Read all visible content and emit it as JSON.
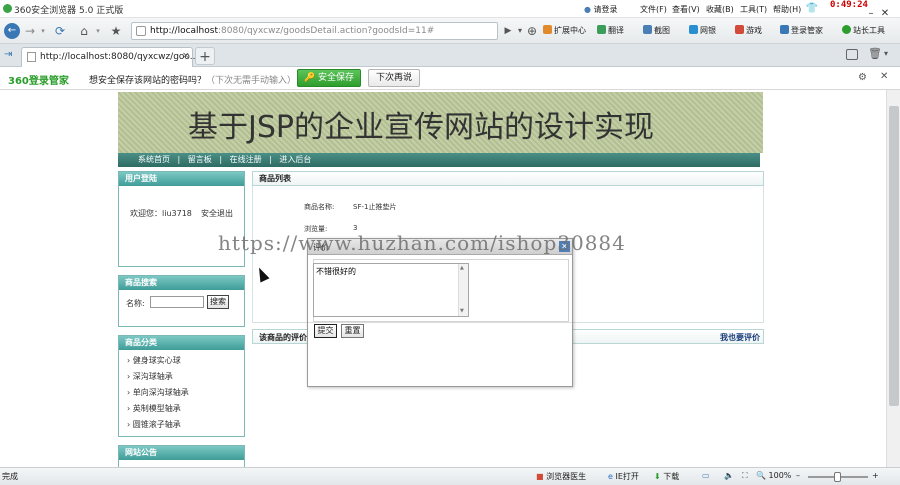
{
  "titlebar": {
    "title": "360安全浏览器 5.0 正式版",
    "login": "请登录",
    "menus": [
      "文件(F)",
      "查看(V)",
      "收藏(B)",
      "工具(T)",
      "帮助(H)"
    ],
    "clock": "0:49:24"
  },
  "navbar": {
    "url_host": "http://localhost",
    "url_rest": ":8080/qyxcwz/goodsDetail.action?goodsId=11#",
    "tools": [
      "扩展中心",
      "翻译",
      "截图",
      "网银",
      "游戏",
      "登录管家",
      "站长工具"
    ]
  },
  "tab": {
    "title": "http://localhost:8080/qyxcwz/goo...",
    "close": "×",
    "new_tab": "+"
  },
  "pwbar": {
    "brand": "360登录管家",
    "question": "想安全保存该网站的密码吗？",
    "hint": "（下次无需手动输入）",
    "save": "安全保存",
    "later": "下次再说"
  },
  "site": {
    "title": "基于JSP的企业宣传网站的设计实现",
    "nav": [
      "系统首页",
      "留言板",
      "在线注册",
      "进入后台"
    ],
    "nav_sep": "|"
  },
  "sidebar": {
    "login_title": "用户登陆",
    "welcome": "欢迎您：liu3718",
    "logout": "安全退出",
    "search_title": "商品搜索",
    "search_label": "名称:",
    "search_btn": "搜索",
    "category_title": "商品分类",
    "categories": [
      "健身球实心球",
      "深沟球轴承",
      "单向深沟球轴承",
      "英制模型轴承",
      "圆锥滚子轴承"
    ],
    "notice_title": "网站公告"
  },
  "main": {
    "list_title": "商品列表",
    "name_label": "商品名称:",
    "name_value": "SF-1止推垫片",
    "views_label": "浏览量:",
    "views_value": "3",
    "review_title": "该商品的评价",
    "review_link": "我也要评价"
  },
  "popup": {
    "title": "评价",
    "close": "✕",
    "text": "不错很好的",
    "submit": "提交",
    "reset": "重置"
  },
  "watermark": "https://www.huzhan.com/ishop30884",
  "statusbar": {
    "left": "完成",
    "doctor": "浏览器医生",
    "ie": "IE打开",
    "download": "下载",
    "zoom": "100%"
  }
}
